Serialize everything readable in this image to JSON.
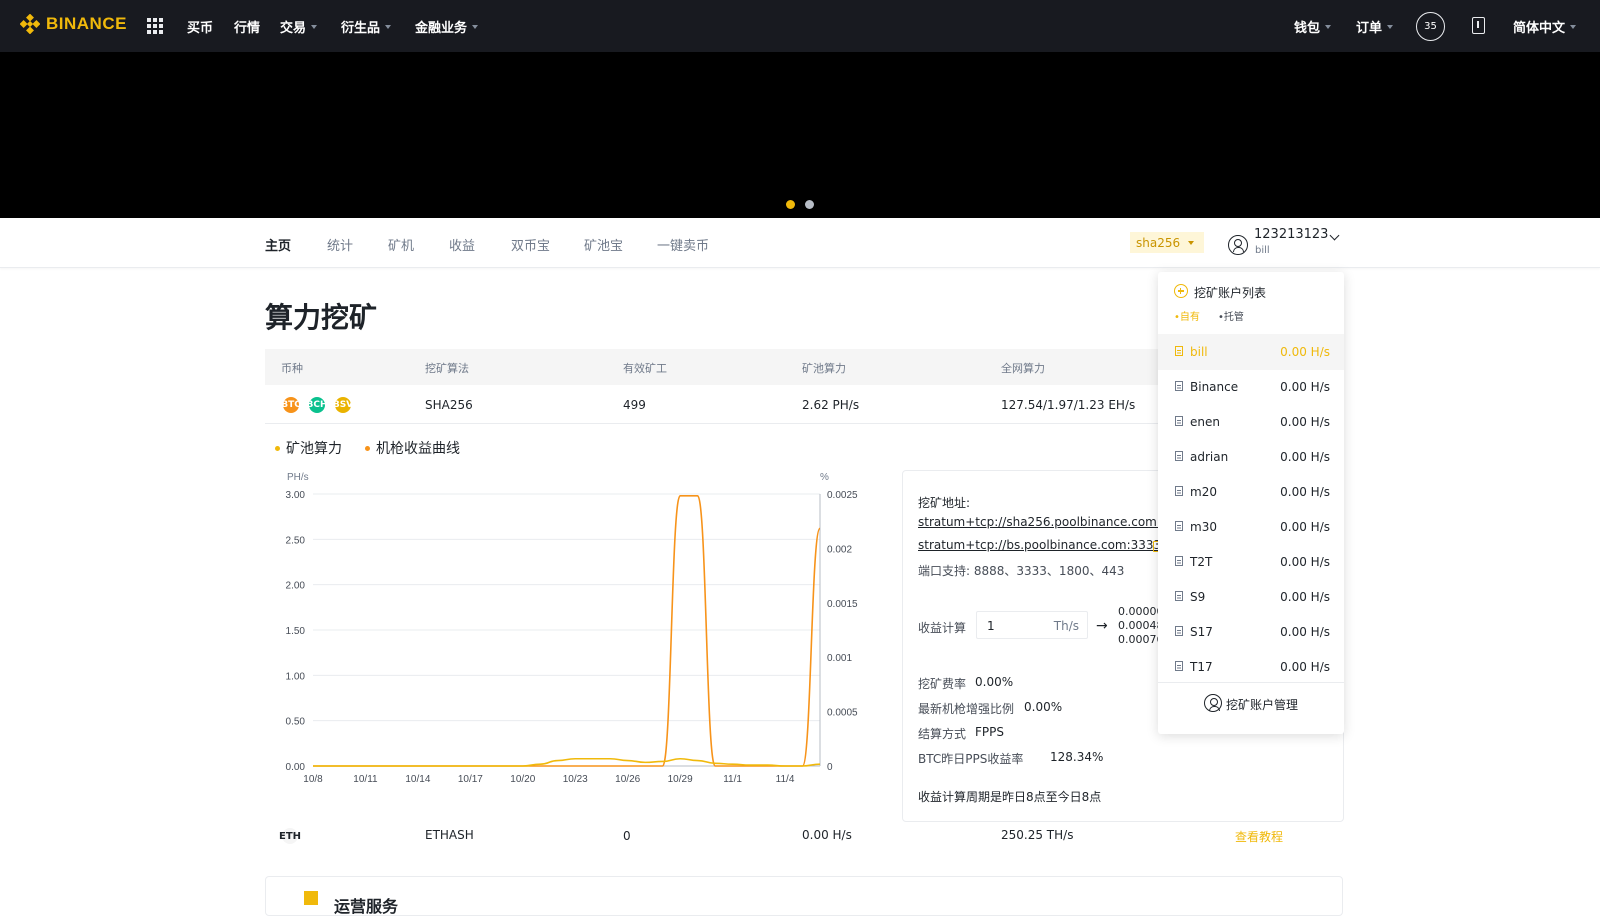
{
  "topbar": {
    "logo_text": "BINANCE",
    "nav": [
      "买币",
      "行情",
      "交易",
      "衍生品",
      "金融业务"
    ],
    "wallet": "钱包",
    "orders": "订单",
    "badge_count": "35",
    "language": "简体中文"
  },
  "banner": {
    "slide_count": 2,
    "active_slide": 0
  },
  "subnav": {
    "tabs": [
      "主页",
      "统计",
      "矿机",
      "收益",
      "双币宝",
      "矿池宝",
      "一键卖币"
    ],
    "algorithm": "sha256",
    "account_id": "123213123",
    "account_sub": "bill"
  },
  "page_title": "算力挖矿",
  "table": {
    "headers": [
      "币种",
      "挖矿算法",
      "有效矿工",
      "矿池算力",
      "全网算力"
    ],
    "rows": [
      {
        "coins": [
          "BTC",
          "BCH",
          "BSV"
        ],
        "algorithm": "SHA256",
        "workers": "499",
        "pool_hashrate": "2.62 PH/s",
        "network_hashrate": "127.54/1.97/1.23 EH/s"
      },
      {
        "coins": [
          "ETH"
        ],
        "algorithm": "ETHASH",
        "workers": "0",
        "pool_hashrate": "0.00 H/s",
        "network_hashrate": "250.25 TH/s",
        "action": "查看教程"
      }
    ]
  },
  "legend": {
    "pool_hashrate": "矿池算力",
    "revenue_curve": "机枪收益曲线"
  },
  "colors": {
    "brand": "#f0b90b",
    "series_pool": "#f0b90b",
    "series_revenue": "#f7931a",
    "topbar": "#181a20"
  },
  "chart_data": {
    "type": "line",
    "left_unit": "PH/s",
    "right_unit": "%",
    "x": [
      "10/8",
      "10/9",
      "10/10",
      "10/11",
      "10/12",
      "10/13",
      "10/14",
      "10/15",
      "10/16",
      "10/17",
      "10/18",
      "10/19",
      "10/20",
      "10/21",
      "10/22",
      "10/23",
      "10/24",
      "10/25",
      "10/26",
      "10/27",
      "10/28",
      "10/29",
      "10/30",
      "10/31",
      "11/1",
      "11/2",
      "11/3",
      "11/4",
      "11/5",
      "11/6"
    ],
    "x_ticks": [
      "10/8",
      "10/11",
      "10/14",
      "10/17",
      "10/20",
      "10/23",
      "10/26",
      "10/29",
      "11/1",
      "11/4"
    ],
    "y_left_ticks": [
      "0.00",
      "0.50",
      "1.00",
      "1.50",
      "2.00",
      "2.50",
      "3.00"
    ],
    "y_right_ticks": [
      "0",
      "0.0005",
      "0.001",
      "0.0015",
      "0.002",
      "0.0025"
    ],
    "ylim_left": [
      0,
      3.0
    ],
    "ylim_right": [
      0,
      0.0025
    ],
    "series": [
      {
        "axis": "left",
        "color": "#f7931a",
        "values": [
          0,
          0,
          0,
          0,
          0,
          0,
          0,
          0,
          0,
          0,
          0,
          0,
          0,
          0,
          0,
          0,
          0,
          0,
          0,
          0,
          0,
          2.98,
          2.98,
          0,
          0,
          0,
          0,
          0,
          0,
          2.62
        ]
      },
      {
        "axis": "left",
        "color": "#f0b90b",
        "values": [
          0,
          0,
          0,
          0,
          0,
          0,
          0,
          0,
          0,
          0,
          0,
          0,
          0,
          0.02,
          0.06,
          0.08,
          0.08,
          0.08,
          0.06,
          0.04,
          0.05,
          0.08,
          0.06,
          0.03,
          0.02,
          0.01,
          0.01,
          0,
          0,
          0.02
        ]
      }
    ]
  },
  "info": {
    "address_label": "挖矿地址:",
    "address_1": "stratum+tcp://sha256.poolbinance.com:888",
    "address_2": "stratum+tcp://bs.poolbinance.com:3333",
    "ports": "端口支持: 8888、3333、1800、443",
    "calc_label": "收益计算",
    "calc_value": "1",
    "calc_unit": "Th/s",
    "results": [
      "0.00000",
      "0.00048",
      "0.00076"
    ],
    "fee_label": "挖矿费率",
    "fee_value": "0.00%",
    "boost_label": "最新机枪增强比例",
    "boost_value": "0.00%",
    "settle_label": "结算方式",
    "settle_value": "FPPS",
    "pps_label": "BTC昨日PPS收益率",
    "pps_value": "128.34%",
    "period_note": "收益计算周期是昨日8点至今日8点"
  },
  "account_dropdown": {
    "title": "挖矿账户列表",
    "filters": [
      "自有",
      "托管"
    ],
    "accounts": [
      {
        "name": "bill",
        "rate": "0.00 H/s"
      },
      {
        "name": "Binance",
        "rate": "0.00 H/s"
      },
      {
        "name": "enen",
        "rate": "0.00 H/s"
      },
      {
        "name": "adrian",
        "rate": "0.00 H/s"
      },
      {
        "name": "m20",
        "rate": "0.00 H/s"
      },
      {
        "name": "m30",
        "rate": "0.00 H/s"
      },
      {
        "name": "T2T",
        "rate": "0.00 H/s"
      },
      {
        "name": "S9",
        "rate": "0.00 H/s"
      },
      {
        "name": "S17",
        "rate": "0.00 H/s"
      },
      {
        "name": "T17",
        "rate": "0.00 H/s"
      }
    ],
    "manage_label": "挖矿账户管理"
  },
  "bottom": {
    "ops_title": "运营服务"
  }
}
